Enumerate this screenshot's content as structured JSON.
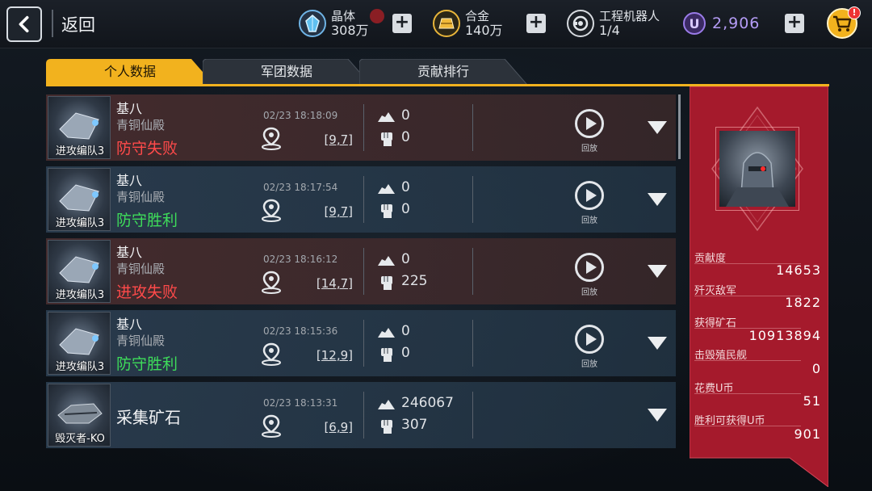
{
  "topbar": {
    "back_label": "返回",
    "crystal": {
      "name": "晶体",
      "value": "308万"
    },
    "alloy": {
      "name": "合金",
      "value": "140万"
    },
    "robot": {
      "name": "工程机器人",
      "value": "1/4"
    },
    "ucoin": {
      "symbol": "U",
      "value": "2,906"
    },
    "cart_badge": "!"
  },
  "tabs": [
    {
      "label": "个人数据",
      "active": true
    },
    {
      "label": "军团数据",
      "active": false
    },
    {
      "label": "贡献排行",
      "active": false
    }
  ],
  "rows": [
    {
      "player": "基八",
      "guild": "青铜仙殿",
      "result": "防守失败",
      "result_color": "red",
      "fleet": "进攻编队3",
      "time": "02/23 18:18:09",
      "coord": "[9,7]",
      "stat1": "0",
      "stat2": "0",
      "replay_label": "回放",
      "tone": "reddish"
    },
    {
      "player": "基八",
      "guild": "青铜仙殿",
      "result": "防守胜利",
      "result_color": "green",
      "fleet": "进攻编队3",
      "time": "02/23 18:17:54",
      "coord": "[9,7]",
      "stat1": "0",
      "stat2": "0",
      "replay_label": "回放",
      "tone": "bluish"
    },
    {
      "player": "基八",
      "guild": "青铜仙殿",
      "result": "进攻失败",
      "result_color": "red",
      "fleet": "进攻编队3",
      "time": "02/23 18:16:12",
      "coord": "[14,7]",
      "stat1": "0",
      "stat2": "225",
      "replay_label": "回放",
      "tone": "reddish"
    },
    {
      "player": "基八",
      "guild": "青铜仙殿",
      "result": "防守胜利",
      "result_color": "green",
      "fleet": "进攻编队3",
      "time": "02/23 18:15:36",
      "coord": "[12,9]",
      "stat1": "0",
      "stat2": "0",
      "replay_label": "回放",
      "tone": "bluish"
    }
  ],
  "mining_row": {
    "mission": "采集矿石",
    "fleet": "毁灭者-KO",
    "time": "02/23 18:13:31",
    "coord": "[6,9]",
    "stat1": "246067",
    "stat2": "307",
    "tone": "bluish"
  },
  "side_panel": {
    "stats": [
      {
        "label": "贡献度",
        "value": "14653"
      },
      {
        "label": "歼灭敌军",
        "value": "1822"
      },
      {
        "label": "获得矿石",
        "value": "10913894"
      },
      {
        "label": "击毁殖民舰",
        "value": "0"
      },
      {
        "label": "花费U币",
        "value": "51"
      },
      {
        "label": "胜利可获得U币",
        "value": "901"
      }
    ]
  },
  "colors": {
    "accent": "#f2b21e",
    "panel": "#a51a2c",
    "loss": "#ff4a4a",
    "win": "#3edc5a",
    "ucoin": "#b49cf5"
  },
  "icons": [
    "back-arrow-icon",
    "crystal-icon",
    "alloy-icon",
    "robot-icon",
    "ucoin-icon",
    "cart-icon",
    "location-pin-icon",
    "ore-icon",
    "fist-icon",
    "replay-icon",
    "chevron-down-icon"
  ]
}
